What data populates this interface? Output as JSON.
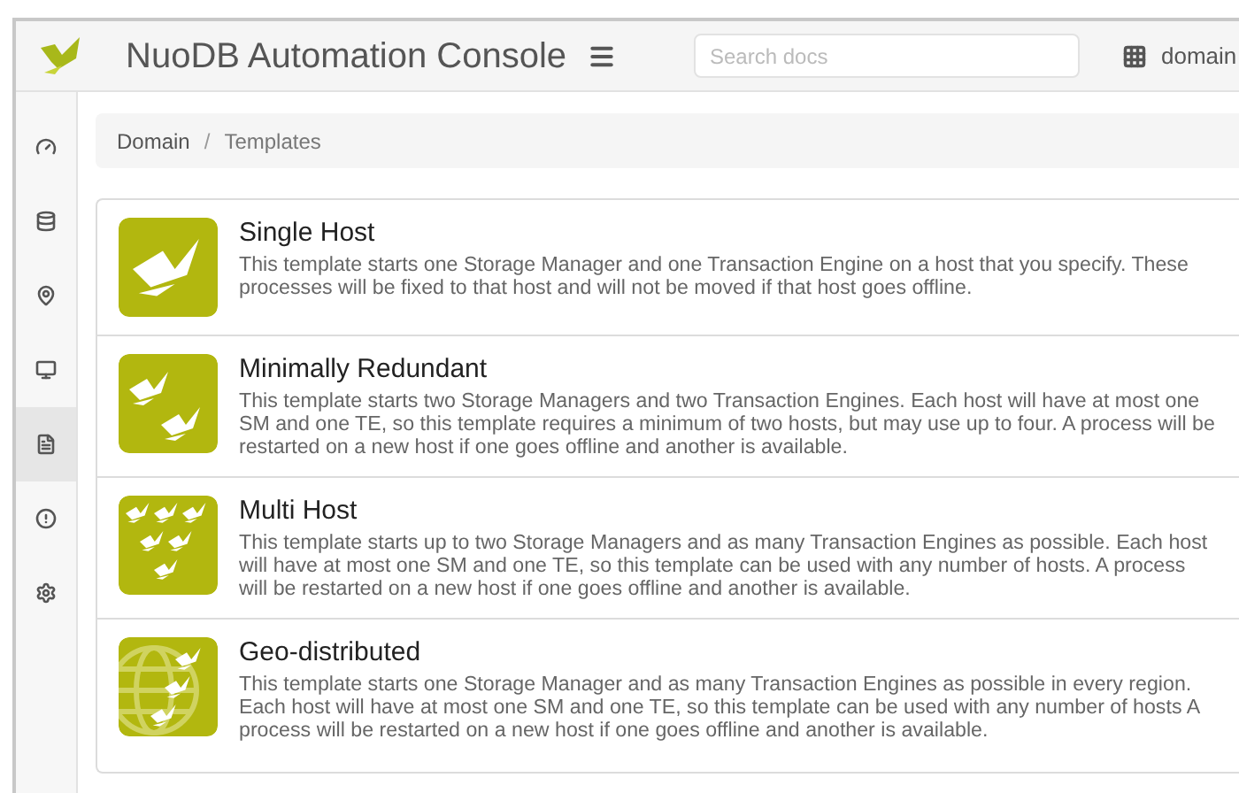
{
  "header": {
    "title": "NuoDB Automation Console",
    "search": {
      "placeholder": "Search docs"
    },
    "account": "domain"
  },
  "sidebar": {
    "items": [
      {
        "kind": "dashboard",
        "selected": false
      },
      {
        "kind": "database",
        "selected": false
      },
      {
        "kind": "location",
        "selected": false
      },
      {
        "kind": "hosts",
        "selected": false
      },
      {
        "kind": "templates",
        "selected": true
      },
      {
        "kind": "alerts",
        "selected": false
      },
      {
        "kind": "settings",
        "selected": false
      }
    ]
  },
  "breadcrumb": {
    "separator": "/",
    "items": [
      "Domain",
      "Templates"
    ]
  },
  "templates": [
    {
      "kind": "single",
      "title": "Single Host",
      "description": "This template starts one Storage Manager and one Transaction Engine on a host that you specify. These processes will be fixed to that host and will not be moved if that host goes offline."
    },
    {
      "kind": "redundant",
      "title": "Minimally Redundant",
      "description": "This template starts two Storage Managers and two Transaction Engines. Each host will have at most one SM and one TE, so this template requires a minimum of two hosts, but may use up to four. A process will be restarted on a new host if one goes offline and another is available."
    },
    {
      "kind": "multi",
      "title": "Multi Host",
      "description": "This template starts up to two Storage Managers and as many Transaction Engines as possible. Each host will have at most one SM and one TE, so this template can be used with any number of hosts. A process will be restarted on a new host if one goes offline and another is available."
    },
    {
      "kind": "geo",
      "title": "Geo-distributed",
      "description": "This template starts one Storage Manager and as many Transaction Engines as possible in every region. Each host will have at most one SM and one TE, so this template can be used with any number of hosts A process will be restarted on a new host if one goes offline and another is available."
    }
  ]
}
